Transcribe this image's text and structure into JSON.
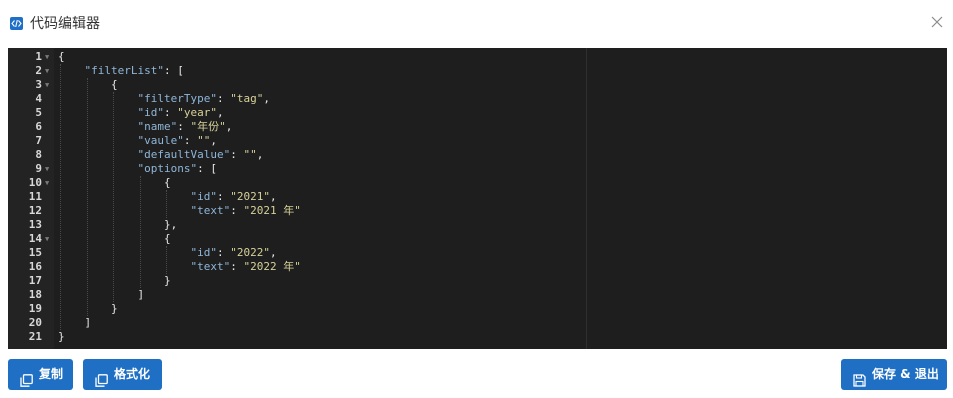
{
  "dialog": {
    "title": "代码编辑器",
    "icons": {
      "title": "code-icon",
      "close": "close-icon"
    }
  },
  "editor": {
    "lines": [
      {
        "n": "1",
        "fold": true,
        "indent": 0,
        "tokens": [
          [
            "p",
            "{"
          ]
        ]
      },
      {
        "n": "2",
        "fold": true,
        "indent": 1,
        "tokens": [
          [
            "k",
            "\"filterList\""
          ],
          [
            "p",
            ": ["
          ]
        ]
      },
      {
        "n": "3",
        "fold": true,
        "indent": 2,
        "tokens": [
          [
            "p",
            "{"
          ]
        ]
      },
      {
        "n": "4",
        "fold": false,
        "indent": 3,
        "tokens": [
          [
            "k",
            "\"filterType\""
          ],
          [
            "p",
            ": "
          ],
          [
            "s",
            "\"tag\""
          ],
          [
            "p",
            ","
          ]
        ]
      },
      {
        "n": "5",
        "fold": false,
        "indent": 3,
        "tokens": [
          [
            "k",
            "\"id\""
          ],
          [
            "p",
            ": "
          ],
          [
            "s",
            "\"year\""
          ],
          [
            "p",
            ","
          ]
        ]
      },
      {
        "n": "6",
        "fold": false,
        "indent": 3,
        "tokens": [
          [
            "k",
            "\"name\""
          ],
          [
            "p",
            ": "
          ],
          [
            "s",
            "\"年份\""
          ],
          [
            "p",
            ","
          ]
        ]
      },
      {
        "n": "7",
        "fold": false,
        "indent": 3,
        "tokens": [
          [
            "k",
            "\"vaule\""
          ],
          [
            "p",
            ": "
          ],
          [
            "s",
            "\"\""
          ],
          [
            "p",
            ","
          ]
        ]
      },
      {
        "n": "8",
        "fold": false,
        "indent": 3,
        "tokens": [
          [
            "k",
            "\"defaultValue\""
          ],
          [
            "p",
            ": "
          ],
          [
            "s",
            "\"\""
          ],
          [
            "p",
            ","
          ]
        ]
      },
      {
        "n": "9",
        "fold": true,
        "indent": 3,
        "tokens": [
          [
            "k",
            "\"options\""
          ],
          [
            "p",
            ": ["
          ]
        ]
      },
      {
        "n": "10",
        "fold": true,
        "indent": 4,
        "tokens": [
          [
            "p",
            "{"
          ]
        ]
      },
      {
        "n": "11",
        "fold": false,
        "indent": 5,
        "tokens": [
          [
            "k",
            "\"id\""
          ],
          [
            "p",
            ": "
          ],
          [
            "s",
            "\"2021\""
          ],
          [
            "p",
            ","
          ]
        ]
      },
      {
        "n": "12",
        "fold": false,
        "indent": 5,
        "tokens": [
          [
            "k",
            "\"text\""
          ],
          [
            "p",
            ": "
          ],
          [
            "s",
            "\"2021 年\""
          ]
        ]
      },
      {
        "n": "13",
        "fold": false,
        "indent": 4,
        "tokens": [
          [
            "p",
            "},"
          ]
        ]
      },
      {
        "n": "14",
        "fold": true,
        "indent": 4,
        "tokens": [
          [
            "p",
            "{"
          ]
        ]
      },
      {
        "n": "15",
        "fold": false,
        "indent": 5,
        "tokens": [
          [
            "k",
            "\"id\""
          ],
          [
            "p",
            ": "
          ],
          [
            "s",
            "\"2022\""
          ],
          [
            "p",
            ","
          ]
        ]
      },
      {
        "n": "16",
        "fold": false,
        "indent": 5,
        "tokens": [
          [
            "k",
            "\"text\""
          ],
          [
            "p",
            ": "
          ],
          [
            "s",
            "\"2022 年\""
          ]
        ]
      },
      {
        "n": "17",
        "fold": false,
        "indent": 4,
        "tokens": [
          [
            "p",
            "}"
          ]
        ]
      },
      {
        "n": "18",
        "fold": false,
        "indent": 3,
        "tokens": [
          [
            "p",
            "]"
          ]
        ]
      },
      {
        "n": "19",
        "fold": false,
        "indent": 2,
        "tokens": [
          [
            "p",
            "}"
          ]
        ]
      },
      {
        "n": "20",
        "fold": false,
        "indent": 1,
        "tokens": [
          [
            "p",
            "]"
          ]
        ]
      },
      {
        "n": "21",
        "fold": false,
        "indent": 0,
        "tokens": [
          [
            "p",
            "}"
          ]
        ]
      }
    ]
  },
  "footer": {
    "copy_label": "复制",
    "format_label": "格式化",
    "save_exit_label": "保存 & 退出",
    "icons": {
      "copy": "copy-icon",
      "format": "copy-icon",
      "save": "save-icon"
    }
  },
  "colors": {
    "accent": "#1f70c4",
    "editor_bg": "#1e1e1e",
    "key": "#8fb6d8",
    "string": "#d7d29a"
  }
}
